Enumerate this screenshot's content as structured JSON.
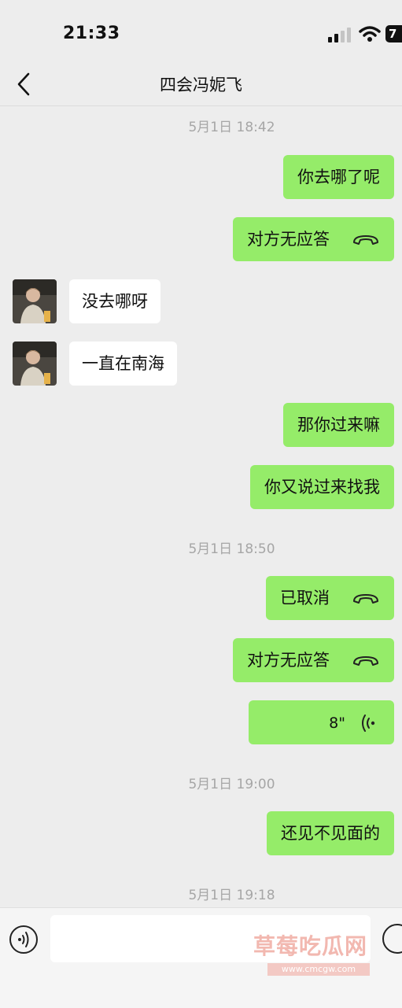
{
  "status": {
    "time": "21:33",
    "battery": "7"
  },
  "header": {
    "title": "四会冯妮飞"
  },
  "messages": {
    "ts1": "5月1日 18:42",
    "m1": "你去哪了呢",
    "m2": "对方无应答",
    "m3": "没去哪呀",
    "m4": "一直在南海",
    "m5": "那你过来嘛",
    "m6": "你又说过来找我",
    "ts2": "5月1日 18:50",
    "m7": "已取消",
    "m8": "对方无应答",
    "m9_duration": "8\"",
    "ts3": "5月1日 19:00",
    "m10": "还见不见面的",
    "ts4": "5月1日 19:18"
  },
  "watermark": {
    "main": "草莓吃瓜网",
    "sub": "www.cmcgw.com"
  },
  "colors": {
    "outgoing": "#95ec69",
    "incoming": "#ffffff",
    "background": "#ededed"
  },
  "icons": {
    "back": "chevron-left-icon",
    "call": "phone-hangup-icon",
    "voice": "voice-wave-icon"
  }
}
